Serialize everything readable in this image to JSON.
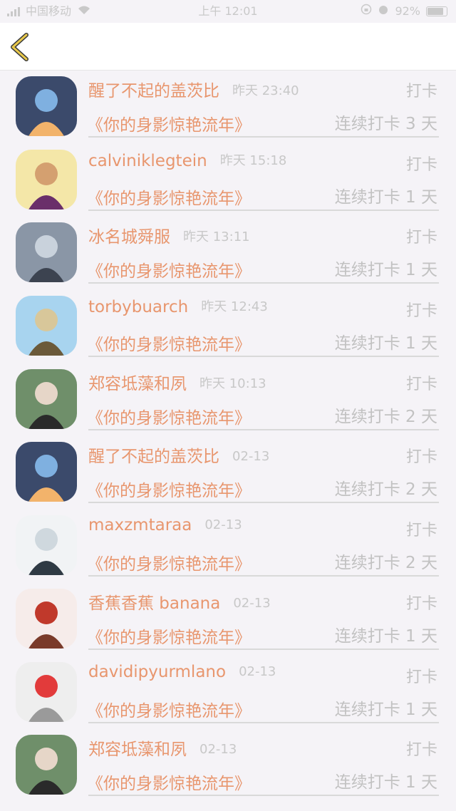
{
  "status_bar": {
    "carrier": "中国移动",
    "time": "上午 12:01",
    "battery": "92%",
    "battery_level": 0.92
  },
  "nav": {
    "back_icon": "chevron-left-icon"
  },
  "checkin_label": "打卡",
  "rows": [
    {
      "name": "醒了不起的盖茨比",
      "time": "昨天 23:40",
      "book": "《你的身影惊艳流年》",
      "streak": "连续打卡 3 天",
      "avatar_colors": [
        "#3b4a6b",
        "#f2b36b",
        "#7fb0e0"
      ]
    },
    {
      "name": "calviniklegtein",
      "time": "昨天 15:18",
      "book": "《你的身影惊艳流年》",
      "streak": "连续打卡 1 天",
      "avatar_colors": [
        "#f4e7a8",
        "#6a2f6a",
        "#d4a070"
      ]
    },
    {
      "name": "冰名城舜服",
      "time": "昨天 13:11",
      "book": "《你的身影惊艳流年》",
      "streak": "连续打卡 1 天",
      "avatar_colors": [
        "#8a96a6",
        "#3c4350",
        "#c9d2dc"
      ]
    },
    {
      "name": "torbybuarch",
      "time": "昨天 12:43",
      "book": "《你的身影惊艳流年》",
      "streak": "连续打卡 1 天",
      "avatar_colors": [
        "#a8d4ef",
        "#6b5a3a",
        "#d8c79a"
      ]
    },
    {
      "name": "郑容坻藻和夙",
      "time": "昨天 10:13",
      "book": "《你的身影惊艳流年》",
      "streak": "连续打卡 2 天",
      "avatar_colors": [
        "#6f8f6a",
        "#2a2a2a",
        "#e6d6c8"
      ]
    },
    {
      "name": "醒了不起的盖茨比",
      "time": "02-13",
      "book": "《你的身影惊艳流年》",
      "streak": "连续打卡 2 天",
      "avatar_colors": [
        "#3b4a6b",
        "#f2b36b",
        "#7fb0e0"
      ]
    },
    {
      "name": "maxzmtaraa",
      "time": "02-13",
      "book": "《你的身影惊艳流年》",
      "streak": "连续打卡 2 天",
      "avatar_colors": [
        "#f1f3f5",
        "#2f3a44",
        "#cfd8de"
      ]
    },
    {
      "name": "香蕉香蕉 banana",
      "time": "02-13",
      "book": "《你的身影惊艳流年》",
      "streak": "连续打卡 1 天",
      "avatar_colors": [
        "#f6ecea",
        "#7a3b2a",
        "#c0392b"
      ]
    },
    {
      "name": "davidipyurmlano",
      "time": "02-13",
      "book": "《你的身影惊艳流年》",
      "streak": "连续打卡 1 天",
      "avatar_colors": [
        "#eeeeee",
        "#9a9a9a",
        "#e23b3b"
      ]
    },
    {
      "name": "郑容坻藻和夙",
      "time": "02-13",
      "book": "《你的身影惊艳流年》",
      "streak": "连续打卡 1 天",
      "avatar_colors": [
        "#6f8f6a",
        "#2a2a2a",
        "#e6d6c8"
      ]
    }
  ]
}
